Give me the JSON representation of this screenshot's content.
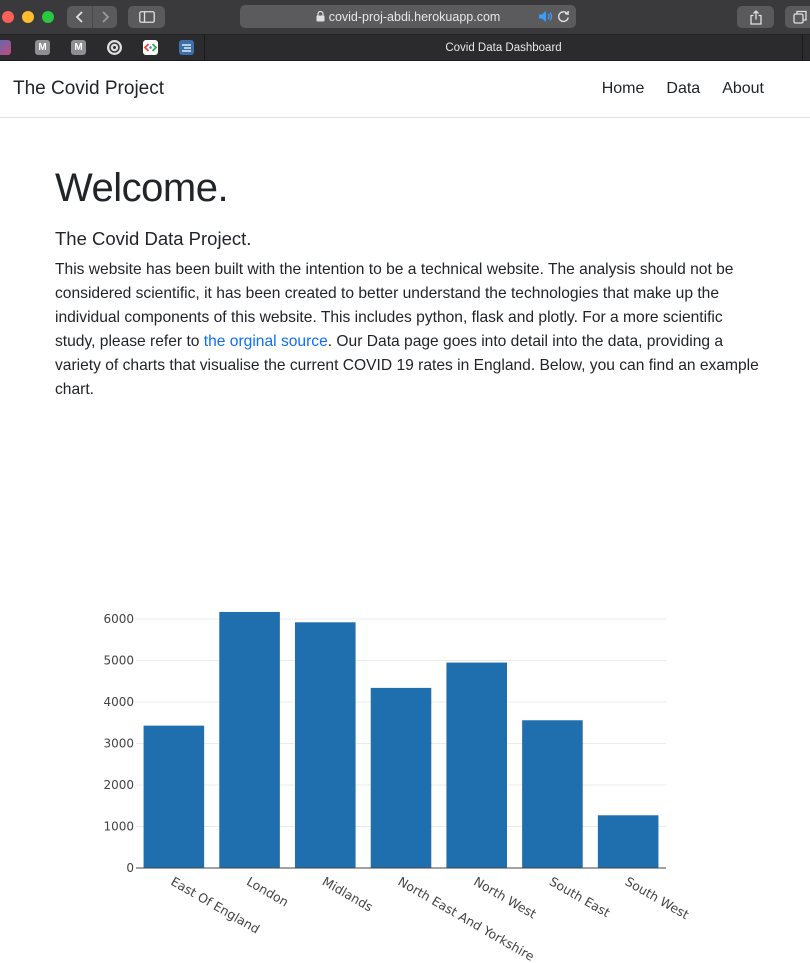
{
  "browser": {
    "url": "covid-proj-abdi.herokuapp.com",
    "tab_title": "Covid Data Dashboard",
    "favorites": [
      "M",
      "M"
    ]
  },
  "navbar": {
    "brand": "The Covid Project",
    "links": [
      "Home",
      "Data",
      "About"
    ]
  },
  "content": {
    "heading": "Welcome.",
    "subtitle": "The Covid Data Project.",
    "intro_before_link": "This website has been built with the intention to be a technical website. The analysis should not be considered scientific, it has been created to better understand the technologies that make up the individual components of this website. This includes python, flask and plotly. For a more scientific study, please refer to ",
    "link_text": "the orginal source",
    "intro_after_link": ". Our Data page goes into detail into the data, providing a variety of charts that visualise the current COVID 19 rates in England. Below, you can find an example chart."
  },
  "chart_data": {
    "type": "bar",
    "categories": [
      "East Of England",
      "London",
      "Midlands",
      "North East And Yorkshire",
      "North West",
      "South East",
      "South West"
    ],
    "values": [
      3430,
      6170,
      5920,
      4340,
      4950,
      3560,
      1270
    ],
    "ylim": [
      0,
      6300
    ],
    "yticks": [
      0,
      1000,
      2000,
      3000,
      4000,
      5000,
      6000
    ],
    "color": "#1f6ead",
    "grid": true
  }
}
